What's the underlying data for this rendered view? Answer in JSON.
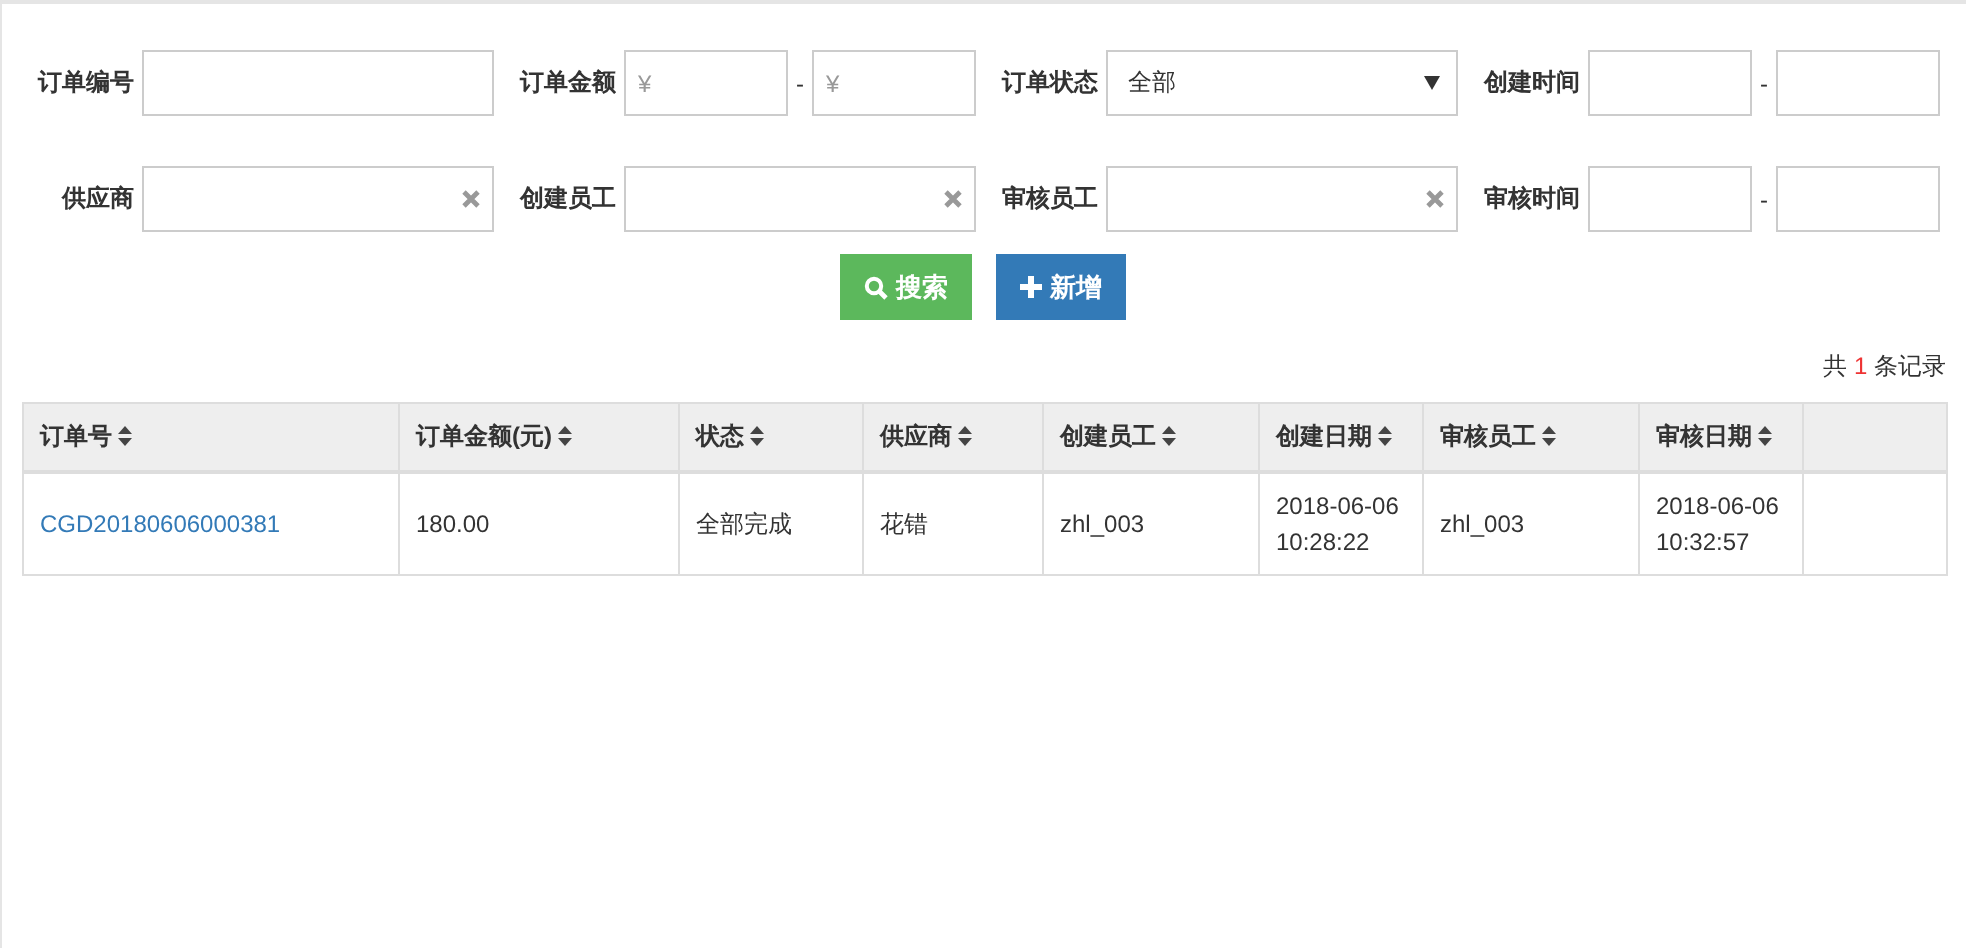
{
  "filters": [
    [
      {
        "label": "订单编号",
        "kind": "text"
      },
      {
        "label": "订单金额",
        "kind": "range",
        "separator": "-",
        "placeholders": [
          "¥",
          "¥"
        ]
      },
      {
        "label": "订单状态",
        "kind": "select",
        "value": "全部"
      },
      {
        "label": "创建时间",
        "kind": "range",
        "separator": "-"
      }
    ],
    [
      {
        "label": "供应商",
        "kind": "clearable"
      },
      {
        "label": "创建员工",
        "kind": "clearable"
      },
      {
        "label": "审核员工",
        "kind": "clearable"
      },
      {
        "label": "审核时间",
        "kind": "range",
        "separator": "-"
      }
    ]
  ],
  "buttons": [
    {
      "label": "搜索",
      "kind": "search"
    },
    {
      "label": "新增",
      "kind": "add"
    }
  ],
  "record_count": {
    "prefix": "共",
    "count": "1",
    "suffix": "条记录"
  },
  "table": {
    "columns": [
      {
        "label": "订单号",
        "sortable": true
      },
      {
        "label": "订单金额(元)",
        "sortable": true
      },
      {
        "label": "状态",
        "sortable": true
      },
      {
        "label": "供应商",
        "sortable": true
      },
      {
        "label": "创建员工",
        "sortable": true
      },
      {
        "label": "创建日期",
        "sortable": true
      },
      {
        "label": "审核员工",
        "sortable": true
      },
      {
        "label": "审核日期",
        "sortable": true
      },
      {
        "sortable": false
      }
    ],
    "rows": [
      {
        "cells": [
          {
            "text": "CGD20180606000381",
            "kind": "link"
          },
          {
            "text": "180.00"
          },
          {
            "text": "全部完成"
          },
          {
            "text": "花错"
          },
          {
            "text": "zhl_003"
          },
          {
            "text": "2018-06-06 10:28:22"
          },
          {
            "text": "zhl_003"
          },
          {
            "text": "2018-06-06 10:32:57"
          },
          {
            "kind": "empty"
          }
        ]
      }
    ]
  }
}
